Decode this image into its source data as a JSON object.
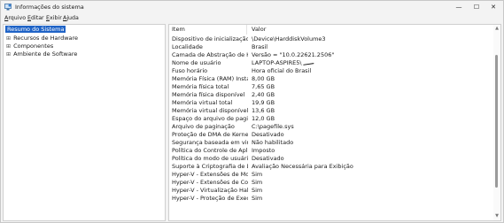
{
  "window": {
    "title": "Informações do sistema",
    "controls": {
      "minimize": "—",
      "maximize": "☐",
      "close": "✕"
    }
  },
  "menu": [
    {
      "label": "Arquivo"
    },
    {
      "label": "Editar"
    },
    {
      "label": "Exibir"
    },
    {
      "label": "Ajuda"
    }
  ],
  "tree": [
    {
      "label": "Resumo do Sistema",
      "selected": true,
      "expander": ""
    },
    {
      "label": "Recursos de Hardware",
      "expander": "⊞"
    },
    {
      "label": "Componentes",
      "expander": "⊞"
    },
    {
      "label": "Ambiente de Software",
      "expander": "⊞"
    }
  ],
  "table": {
    "headers": {
      "item": "Item",
      "value": "Valor"
    },
    "rows": [
      {
        "item": "Dispositivo de inicialização",
        "value": "\\Device\\HarddiskVolume3"
      },
      {
        "item": "Localidade",
        "value": "Brasil"
      },
      {
        "item": "Camada de Abstração de Hard...",
        "value": "Versão = \"10.0.22621.2506\""
      },
      {
        "item": "Nome de usuário",
        "value": "LAPTOP-ASPIRE5\\"
      },
      {
        "item": "Fuso horário",
        "value": "Hora oficial do Brasil"
      },
      {
        "item": "Memória Física (RAM) Instalada",
        "value": "8,00 GB"
      },
      {
        "item": "Memória física total",
        "value": "7,65 GB"
      },
      {
        "item": "Memória física disponível",
        "value": "2,40 GB"
      },
      {
        "item": "Memória virtual total",
        "value": "19,9 GB"
      },
      {
        "item": "Memória virtual disponível",
        "value": "13,6 GB"
      },
      {
        "item": "Espaço do arquivo de paginaç...",
        "value": "12,0 GB"
      },
      {
        "item": "Arquivo de paginação",
        "value": "C:\\pagefile.sys"
      },
      {
        "item": "Proteção de DMA de Kernel",
        "value": "Desativado"
      },
      {
        "item": "Segurança baseada em virtuali...",
        "value": "Não habilitado"
      },
      {
        "item": "Política do Controle de Aplicati...",
        "value": "Imposto"
      },
      {
        "item": "Política do modo de usuário d...",
        "value": "Desativado"
      },
      {
        "item": "Suporte à Criptografia de Disp...",
        "value": "Avaliação Necessária para Exibição"
      },
      {
        "item": "Hyper-V - Extensões de Modo ...",
        "value": "Sim"
      },
      {
        "item": "Hyper-V - Extensões de Conver...",
        "value": "Sim"
      },
      {
        "item": "Hyper-V - Virtualização Habilita...",
        "value": "Sim"
      },
      {
        "item": "Hyper-V - Proteção de Execuçã...",
        "value": "Sim"
      }
    ]
  }
}
